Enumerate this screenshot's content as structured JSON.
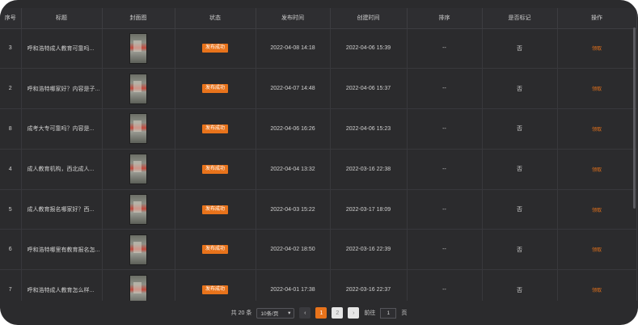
{
  "columns": [
    "序号",
    "标题",
    "封面图",
    "状态",
    "发布时间",
    "创建时间",
    "排序",
    "是否标记",
    "操作"
  ],
  "rows": [
    {
      "index": "3",
      "title": "呼和浩特成人教育可靠吗...",
      "status": "发布成功",
      "publish_time": "2022-04-08 14:18",
      "create_time": "2022-04-06 15:39",
      "sort": "--",
      "marked": "否",
      "action": "领取"
    },
    {
      "index": "2",
      "title": "呼和浩特哪家好？内容是子...",
      "status": "发布成功",
      "publish_time": "2022-04-07 14:48",
      "create_time": "2022-04-06 15:37",
      "sort": "--",
      "marked": "否",
      "action": "领取"
    },
    {
      "index": "8",
      "title": "成考大专可靠吗？内容是...",
      "status": "发布成功",
      "publish_time": "2022-04-06 16:26",
      "create_time": "2022-04-06 15:23",
      "sort": "--",
      "marked": "否",
      "action": "领取"
    },
    {
      "index": "4",
      "title": "成人教育机构，西北成人...",
      "status": "发布成功",
      "publish_time": "2022-04-04 13:32",
      "create_time": "2022-03-16 22:38",
      "sort": "--",
      "marked": "否",
      "action": "领取"
    },
    {
      "index": "5",
      "title": "成人教育报名哪家好？西...",
      "status": "发布成功",
      "publish_time": "2022-04-03 15:22",
      "create_time": "2022-03-17 18:09",
      "sort": "--",
      "marked": "否",
      "action": "领取"
    },
    {
      "index": "6",
      "title": "呼和浩特哪里有教育报名怎...",
      "status": "发布成功",
      "publish_time": "2022-04-02 18:50",
      "create_time": "2022-03-16 22:39",
      "sort": "--",
      "marked": "否",
      "action": "领取"
    },
    {
      "index": "7",
      "title": "呼和浩特成人教育怎么样...",
      "status": "发布成功",
      "publish_time": "2022-04-01 17:38",
      "create_time": "2022-03-16 22:37",
      "sort": "--",
      "marked": "否",
      "action": "领取"
    }
  ],
  "pagination": {
    "total_label": "共 20 条",
    "page_size": "10条/页",
    "prev": "‹",
    "pages": [
      "1",
      "2"
    ],
    "next": "›",
    "goto_label": "前往",
    "goto_value": "1",
    "page_unit": "页"
  },
  "colors": {
    "accent": "#e8731b",
    "background": "#2b2b2d"
  }
}
